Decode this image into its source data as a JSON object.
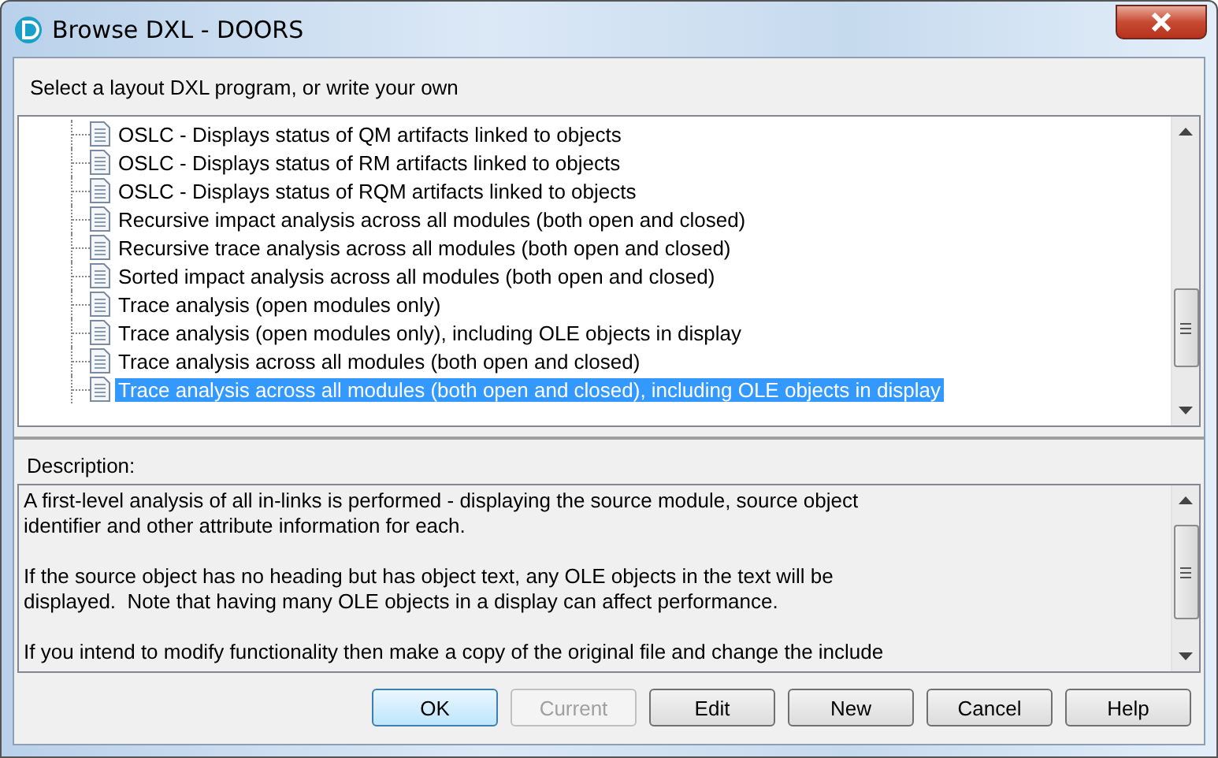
{
  "window": {
    "title": "Browse DXL - DOORS"
  },
  "prompt": "Select a layout DXL program, or write your own",
  "programs": [
    {
      "label": "OSLC - Displays status of QM artifacts linked to objects",
      "selected": false
    },
    {
      "label": "OSLC - Displays status of RM artifacts linked to objects",
      "selected": false
    },
    {
      "label": "OSLC - Displays status of RQM artifacts linked to objects",
      "selected": false
    },
    {
      "label": "Recursive impact analysis across all modules (both open and closed)",
      "selected": false
    },
    {
      "label": "Recursive trace analysis across all modules (both open and closed)",
      "selected": false
    },
    {
      "label": "Sorted impact analysis across all modules (both open and closed)",
      "selected": false
    },
    {
      "label": "Trace analysis (open modules only)",
      "selected": false
    },
    {
      "label": "Trace analysis (open modules only), including OLE objects in display",
      "selected": false
    },
    {
      "label": "Trace analysis across all modules (both open and closed)",
      "selected": false
    },
    {
      "label": "Trace analysis across all modules (both open and closed), including OLE objects in display",
      "selected": true
    }
  ],
  "description": {
    "label": "Description:",
    "paragraphs": [
      "A first-level analysis of all in-links is performed - displaying the source module, source object\nidentifier and other attribute information for each.",
      "If the source object has no heading but has object text, any OLE objects in the text will be\ndisplayed.  Note that having many OLE objects in a display can affect performance.",
      "If you intend to modify functionality then make a copy of the original file and change the include"
    ]
  },
  "buttons": [
    {
      "label": "OK",
      "default": true,
      "disabled": false
    },
    {
      "label": "Current",
      "default": false,
      "disabled": true
    },
    {
      "label": "Edit",
      "default": false,
      "disabled": false
    },
    {
      "label": "New",
      "default": false,
      "disabled": false
    },
    {
      "label": "Cancel",
      "default": false,
      "disabled": false
    },
    {
      "label": "Help",
      "default": false,
      "disabled": false
    }
  ]
}
